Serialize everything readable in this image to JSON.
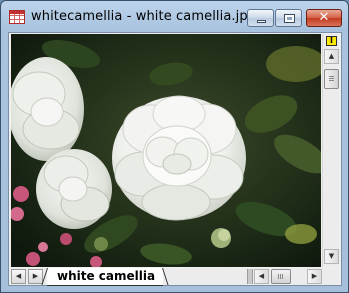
{
  "window": {
    "title": "whitecamellia - white camellia.jp...",
    "close_glyph": "✕"
  },
  "photo": {
    "description_icon": "camellia-photo",
    "background_color": "#1f2e17",
    "flower_color": "#f4f5f2"
  },
  "scrollbar": {
    "split_glyph": "I",
    "up_glyph": "▲",
    "down_glyph": "▼",
    "left_glyph": "◀",
    "right_glyph": "▶",
    "vertical_position": 0.05,
    "horizontal_position": 0.2
  },
  "sheet_tabs": {
    "prev_glyph": "◀",
    "next_glyph": "▶",
    "tabs": [
      {
        "label": "white camellia"
      }
    ]
  }
}
